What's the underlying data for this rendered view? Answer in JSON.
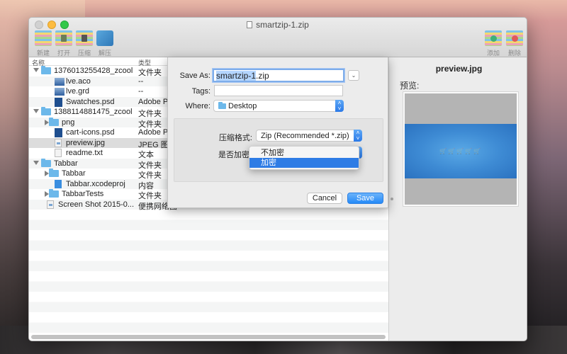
{
  "window": {
    "title": "smartzip-1.zip"
  },
  "toolbar": {
    "left": [
      {
        "label": "新建",
        "icon": "new-archive-icon"
      },
      {
        "label": "打开",
        "icon": "open-archive-icon"
      },
      {
        "label": "压缩",
        "icon": "compress-icon"
      },
      {
        "label": "解压",
        "icon": "extract-icon"
      }
    ],
    "right": [
      {
        "label": "添加",
        "icon": "add-file-icon"
      },
      {
        "label": "删除",
        "icon": "delete-file-icon"
      }
    ]
  },
  "file_list": {
    "columns": {
      "name": "名称",
      "type": "类型"
    },
    "rows": [
      {
        "name": "1376013255428_zcool",
        "type": "文件夹",
        "icon": "folder",
        "level": 0,
        "disclosure": "down"
      },
      {
        "name": "lve.aco",
        "type": "--",
        "icon": "aco",
        "level": 1,
        "disclosure": ""
      },
      {
        "name": "lve.grd",
        "type": "--",
        "icon": "aco",
        "level": 1,
        "disclosure": ""
      },
      {
        "name": "Swatches.psd",
        "type": "Adobe Pl",
        "icon": "psd",
        "level": 1,
        "disclosure": ""
      },
      {
        "name": "1388114881475_zcool",
        "type": "文件夹",
        "icon": "folder",
        "level": 0,
        "disclosure": "down"
      },
      {
        "name": "png",
        "type": "文件夹",
        "icon": "folder",
        "level": 1,
        "disclosure": "right"
      },
      {
        "name": "cart-icons.psd",
        "type": "Adobe Pl",
        "icon": "psd",
        "level": 1,
        "disclosure": ""
      },
      {
        "name": "preview.jpg",
        "type": "JPEG 图像",
        "icon": "img",
        "level": 1,
        "disclosure": "",
        "selected": true
      },
      {
        "name": "readme.txt",
        "type": "文本",
        "icon": "doc",
        "level": 1,
        "disclosure": ""
      },
      {
        "name": "Tabbar",
        "type": "文件夹",
        "icon": "folder",
        "level": 0,
        "disclosure": "down"
      },
      {
        "name": "Tabbar",
        "type": "文件夹",
        "icon": "folder",
        "level": 1,
        "disclosure": "right"
      },
      {
        "name": "Tabbar.xcodeproj",
        "type": "内容",
        "icon": "xcode",
        "level": 1,
        "disclosure": ""
      },
      {
        "name": "TabbarTests",
        "type": "文件夹",
        "icon": "folder",
        "level": 1,
        "disclosure": "right"
      },
      {
        "name": "Screen Shot 2015-0...",
        "type": "便携网络图",
        "icon": "img",
        "level": 0,
        "disclosure": ""
      }
    ]
  },
  "preview": {
    "filename": "preview.jpg",
    "label": "预览:",
    "cart_glyphs": "🛒🛒🛒🛒🛒"
  },
  "save_dialog": {
    "save_as_label": "Save As:",
    "save_as_selected": "smartzip-1",
    "save_as_ext": ".zip",
    "tags_label": "Tags:",
    "tags_value": "",
    "where_label": "Where:",
    "where_value": "Desktop",
    "format_label": "压缩格式:",
    "format_value": "Zip (Recommended *.zip)",
    "encrypt_label": "是否加密",
    "encrypt_options": [
      "不加密",
      "加密"
    ],
    "encrypt_highlighted": "加密",
    "cancel_label": "Cancel",
    "save_label": "Save"
  }
}
